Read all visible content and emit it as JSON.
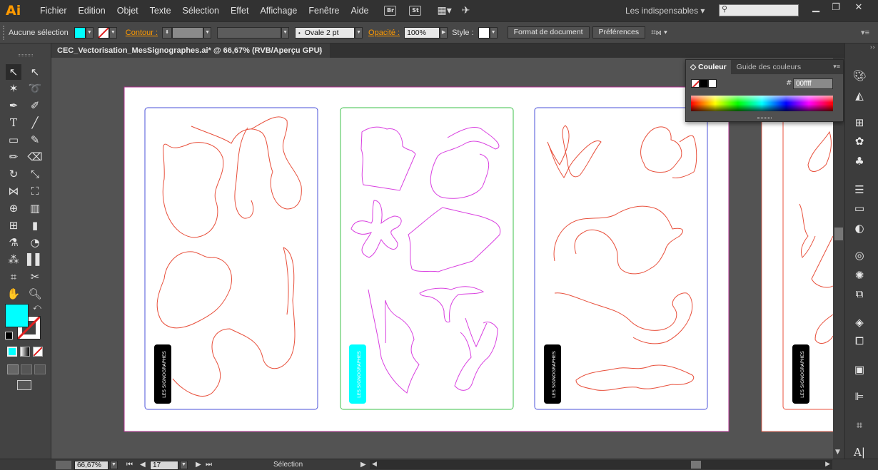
{
  "app": {
    "logo": "Ai",
    "menu": [
      "Fichier",
      "Edition",
      "Objet",
      "Texte",
      "Sélection",
      "Effet",
      "Affichage",
      "Fenêtre",
      "Aide"
    ],
    "bridge_label": "Br",
    "stock_label": "St",
    "workspace": "Les indispensables",
    "accent_color": "#ff9a00"
  },
  "controlbar": {
    "selection_label": "Aucune sélection",
    "fill_color": "#00ffff",
    "contour_label": "Contour :",
    "brush_label": "Ovale 2 pt",
    "opacity_label": "Opacité :",
    "opacity_value": "100%",
    "style_label": "Style :",
    "doc_format_button": "Format de document",
    "prefs_button": "Préférences"
  },
  "document": {
    "tab_title": "CEC_Vectorisation_MesSignographes.ai* @ 66,67% (RVB/Aperçu GPU)",
    "tab_close": "×",
    "badge_text": "LES SIGNOGRAPHES",
    "stroke_red": "#e8503c",
    "stroke_magenta": "#d940e0",
    "badge_cyan": "#00ffff"
  },
  "color_panel": {
    "tab_couleur": "Couleur",
    "tab_guide": "Guide des couleurs",
    "hex_label": "#",
    "hex_value": "00ffff"
  },
  "toolbox": {
    "fill_color": "#00ffff"
  },
  "statusbar": {
    "zoom": "66,67%",
    "page": "17",
    "tool": "Sélection"
  }
}
